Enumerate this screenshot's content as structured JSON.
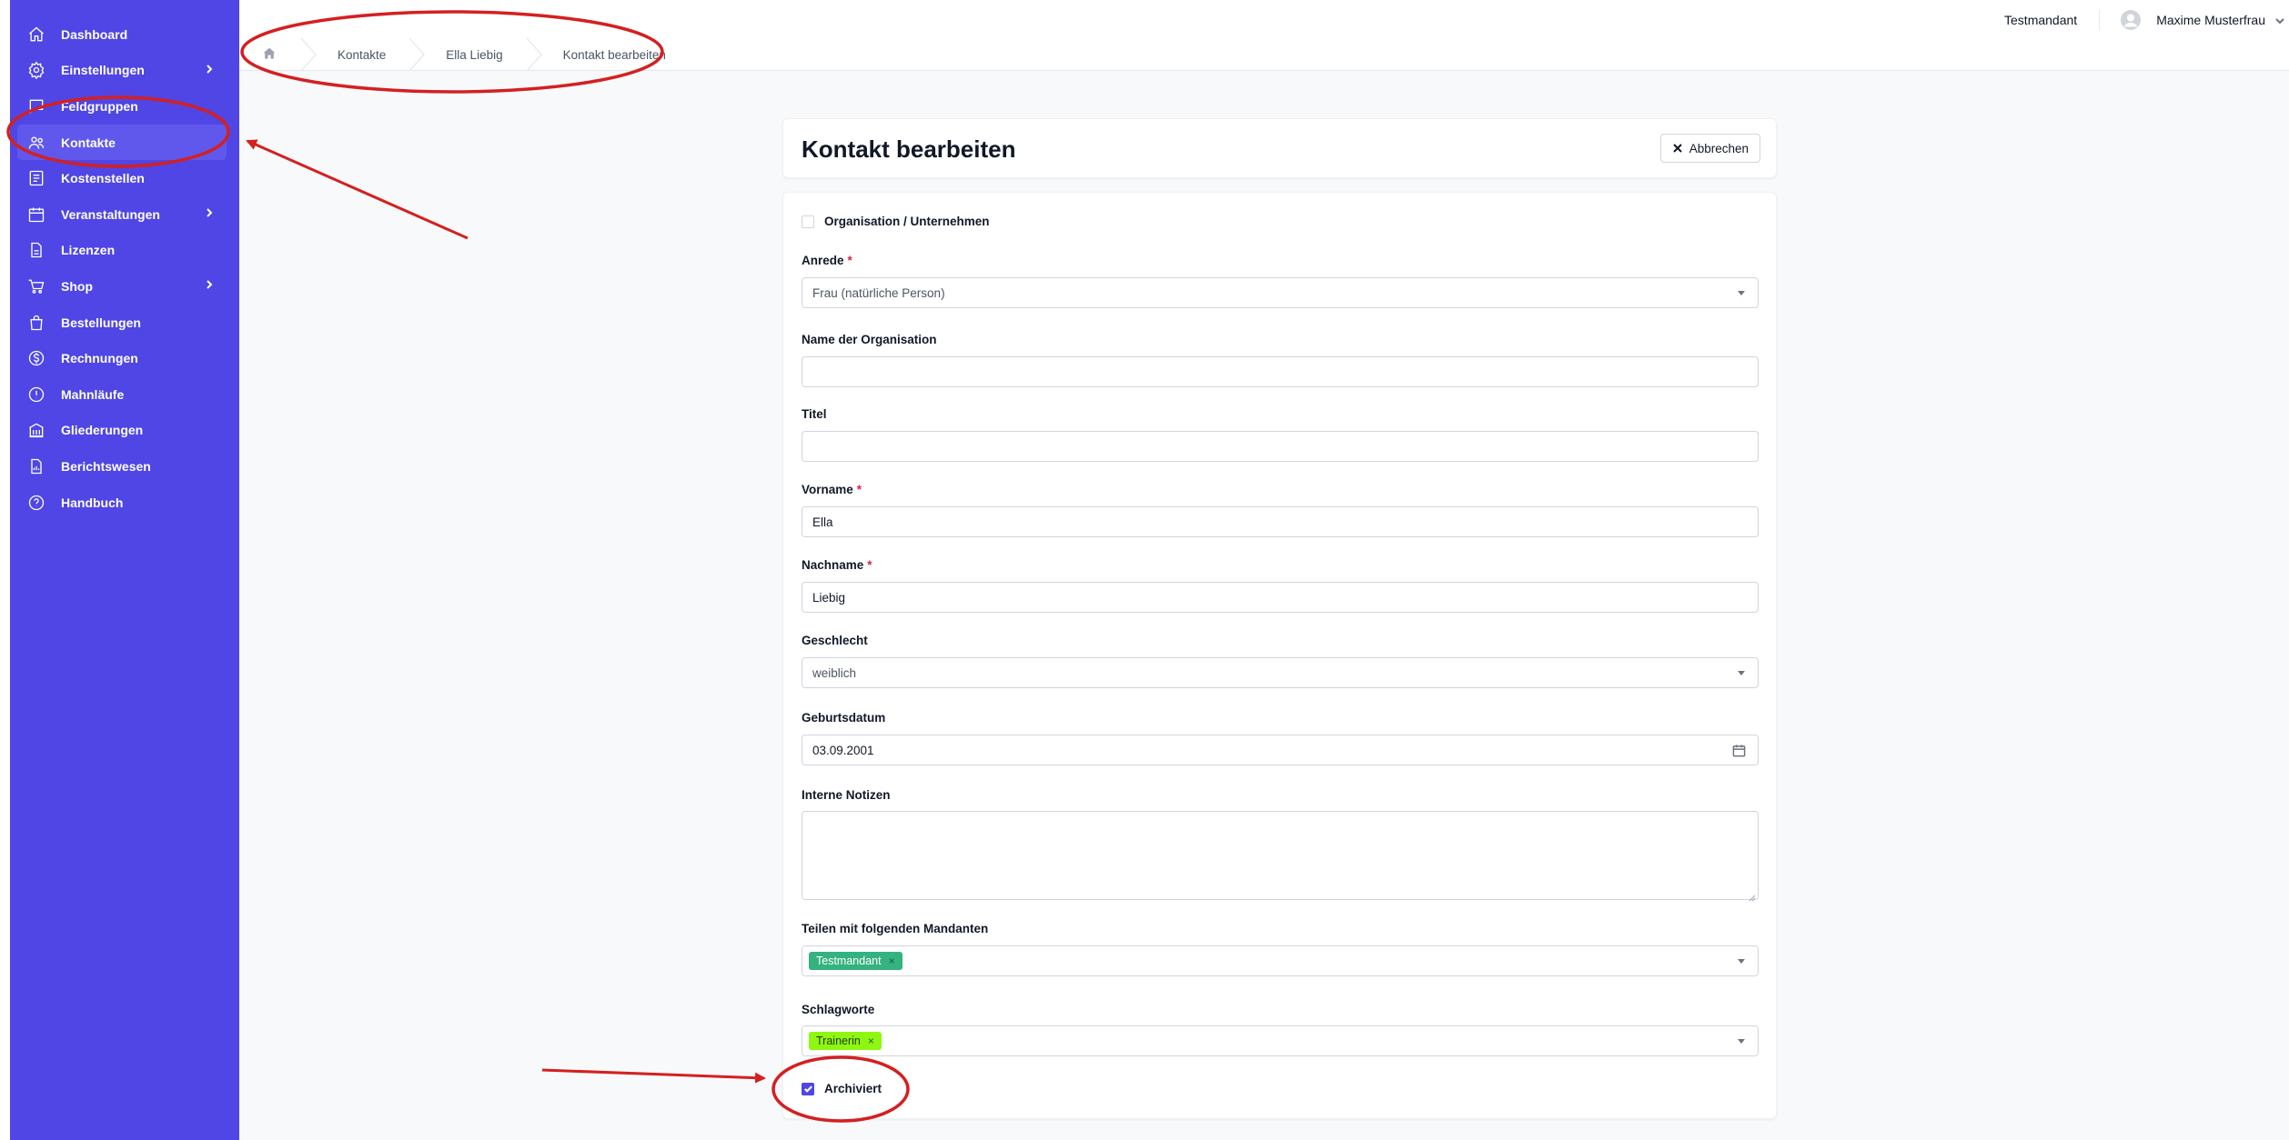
{
  "colors": {
    "sidebar": "#4f46e5",
    "sidebar_active": "#6058ec",
    "annotation_red": "#d42020",
    "tag_mandant": "#34b27f",
    "tag_schlagwort": "#8ef711"
  },
  "sidebar": {
    "items": [
      {
        "label": "Dashboard",
        "icon": "home-icon",
        "has_children": false,
        "active": false
      },
      {
        "label": "Einstellungen",
        "icon": "gear-icon",
        "has_children": true,
        "active": false
      },
      {
        "label": "Feldgruppen",
        "icon": "chat-icon",
        "has_children": false,
        "active": false
      },
      {
        "label": "Kontakte",
        "icon": "users-icon",
        "has_children": false,
        "active": true
      },
      {
        "label": "Kostenstellen",
        "icon": "ledger-icon",
        "has_children": false,
        "active": false
      },
      {
        "label": "Veranstaltungen",
        "icon": "calendar-icon",
        "has_children": true,
        "active": false
      },
      {
        "label": "Lizenzen",
        "icon": "document-icon",
        "has_children": false,
        "active": false
      },
      {
        "label": "Shop",
        "icon": "cart-icon",
        "has_children": true,
        "active": false
      },
      {
        "label": "Bestellungen",
        "icon": "bag-icon",
        "has_children": false,
        "active": false
      },
      {
        "label": "Rechnungen",
        "icon": "dollar-circle-icon",
        "has_children": false,
        "active": false
      },
      {
        "label": "Mahnläufe",
        "icon": "alert-circle-icon",
        "has_children": false,
        "active": false
      },
      {
        "label": "Gliederungen",
        "icon": "building-icon",
        "has_children": false,
        "active": false
      },
      {
        "label": "Berichtswesen",
        "icon": "report-icon",
        "has_children": false,
        "active": false
      },
      {
        "label": "Handbuch",
        "icon": "help-circle-icon",
        "has_children": false,
        "active": false
      }
    ]
  },
  "breadcrumb": {
    "home_icon": "home-icon",
    "items": [
      "Kontakte",
      "Ella Liebig",
      "Kontakt bearbeiten"
    ]
  },
  "topbar": {
    "mandant": "Testmandant",
    "user_name": "Maxime Musterfrau",
    "avatar_icon": "user-circle-icon"
  },
  "page": {
    "title": "Kontakt bearbeiten",
    "cancel_label": "Abbrechen"
  },
  "form": {
    "organisation_checkbox": {
      "label": "Organisation / Unternehmen",
      "checked": false
    },
    "anrede": {
      "label": "Anrede",
      "required": "*",
      "value": "Frau (natürliche Person)"
    },
    "organisation_name": {
      "label": "Name der Organisation",
      "value": ""
    },
    "titel": {
      "label": "Titel",
      "value": ""
    },
    "vorname": {
      "label": "Vorname",
      "required": "*",
      "value": "Ella"
    },
    "nachname": {
      "label": "Nachname",
      "required": "*",
      "value": "Liebig"
    },
    "geschlecht": {
      "label": "Geschlecht",
      "value": "weiblich"
    },
    "geburtsdatum": {
      "label": "Geburtsdatum",
      "value": "03.09.2001"
    },
    "notizen": {
      "label": "Interne Notizen",
      "value": ""
    },
    "mandanten": {
      "label": "Teilen mit folgenden Mandanten",
      "tags": [
        "Testmandant"
      ],
      "remove_glyph": "×"
    },
    "schlagworte": {
      "label": "Schlagworte",
      "tags": [
        "Trainerin"
      ],
      "remove_glyph": "×"
    },
    "archiviert": {
      "label": "Archiviert",
      "checked": true
    }
  }
}
